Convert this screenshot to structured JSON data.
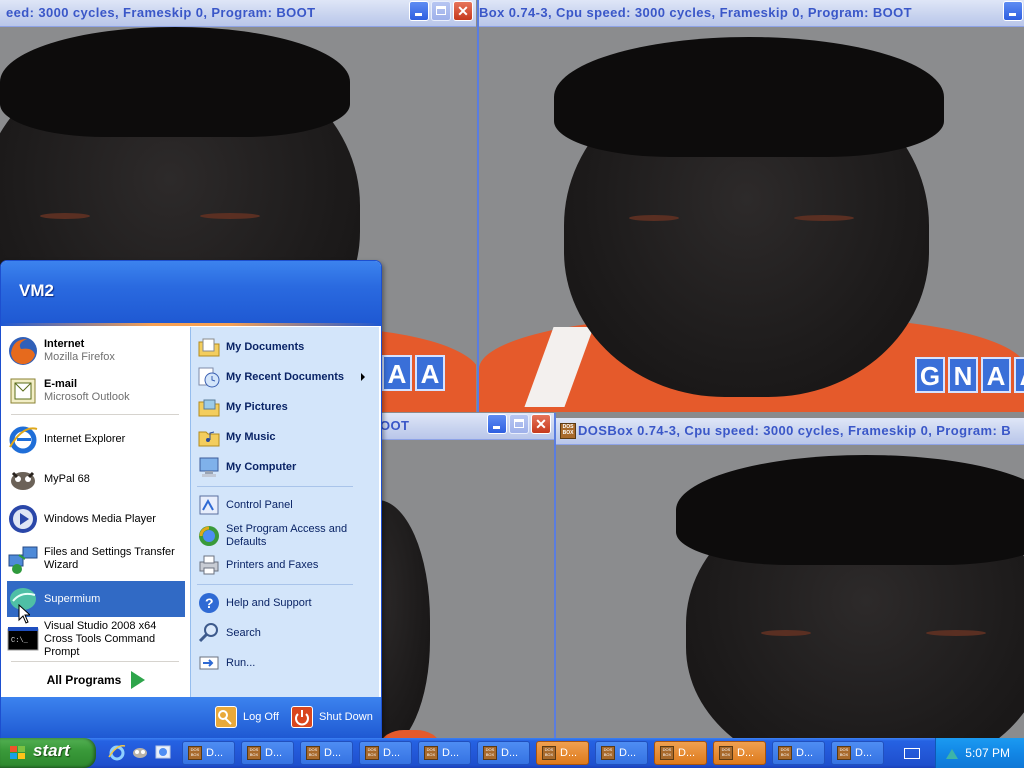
{
  "dosbox_windows": [
    {
      "title": "eed:      3000 cycles, Frameskip  0, Program:      BOOT",
      "logo": [
        "",
        "A",
        "A"
      ]
    },
    {
      "title": "Box 0.74-3, Cpu speed:      3000 cycles, Frameskip  0, Program:      BOOT",
      "logo": [
        "G",
        "N",
        "A",
        "A"
      ]
    },
    {
      "title": "OOT",
      "logo": []
    },
    {
      "title": "DOSBox 0.74-3, Cpu speed:      3000 cycles, Frameskip  0, Program:      B",
      "logo": []
    }
  ],
  "start_menu": {
    "user": "VM2",
    "pinned": [
      {
        "title": "Internet",
        "subtitle": "Mozilla Firefox",
        "icon": "firefox-icon"
      },
      {
        "title": "E-mail",
        "subtitle": "Microsoft Outlook",
        "icon": "outlook-icon"
      }
    ],
    "recent": [
      {
        "label": "Internet Explorer",
        "icon": "internet-explorer-icon"
      },
      {
        "label": "MyPal 68",
        "icon": "mypal-icon"
      },
      {
        "label": "Windows Media Player",
        "icon": "media-player-icon"
      },
      {
        "label": "Files and Settings Transfer Wizard",
        "icon": "transfer-wizard-icon"
      },
      {
        "label": "Supermium",
        "icon": "supermium-icon"
      },
      {
        "label": "Visual Studio 2008 x64 Cross Tools Command Prompt",
        "icon": "command-prompt-icon"
      }
    ],
    "all_programs": "All Programs",
    "right_top": [
      {
        "label": "My Documents",
        "icon": "folder-documents-icon"
      },
      {
        "label": "My Recent Documents",
        "icon": "recent-documents-icon",
        "submenu": true
      },
      {
        "label": "My Pictures",
        "icon": "folder-pictures-icon"
      },
      {
        "label": "My Music",
        "icon": "folder-music-icon"
      },
      {
        "label": "My Computer",
        "icon": "computer-icon"
      }
    ],
    "right_middle": [
      {
        "label": "Control Panel",
        "icon": "control-panel-icon"
      },
      {
        "label": "Set Program Access and Defaults",
        "icon": "program-defaults-icon"
      },
      {
        "label": "Printers and Faxes",
        "icon": "printer-icon"
      }
    ],
    "right_bottom": [
      {
        "label": "Help and Support",
        "icon": "help-icon"
      },
      {
        "label": "Search",
        "icon": "search-icon"
      },
      {
        "label": "Run...",
        "icon": "run-icon"
      }
    ],
    "log_off": "Log Off",
    "shut_down": "Shut Down"
  },
  "taskbar": {
    "start_label": "start",
    "tasks": [
      {
        "label": "D...",
        "active": false
      },
      {
        "label": "D...",
        "active": false
      },
      {
        "label": "D...",
        "active": false
      },
      {
        "label": "D...",
        "active": false
      },
      {
        "label": "D...",
        "active": false
      },
      {
        "label": "D...",
        "active": false
      },
      {
        "label": "D...",
        "active": true
      },
      {
        "label": "D...",
        "active": false
      },
      {
        "label": "D...",
        "active": true
      },
      {
        "label": "D...",
        "active": true
      },
      {
        "label": "D...",
        "active": false
      },
      {
        "label": "D...",
        "active": false
      }
    ],
    "clock": "5:07 PM"
  },
  "colors": {
    "xp_blue": "#245edb",
    "start_green": "#3a9a3a",
    "task_active": "#dd7a1c",
    "shirt_orange": "#e55a2b",
    "logo_blue": "#3a6fd8"
  }
}
